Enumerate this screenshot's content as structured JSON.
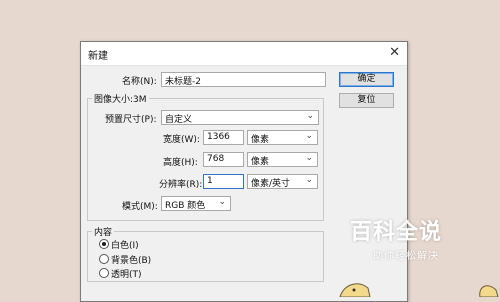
{
  "dialog": {
    "title": "新建",
    "close_glyph": "✕",
    "name_label": "名称(N):",
    "name_value": "未标题-2",
    "ok_label": "确定",
    "reset_label": "复位",
    "size_group_title": "图像大小:3M",
    "preset_label": "预置尺寸(P):",
    "preset_value": "自定义",
    "width_label": "宽度(W):",
    "width_value": "1366",
    "width_unit": "像素",
    "height_label": "高度(H):",
    "height_value": "768",
    "height_unit": "像素",
    "resolution_label": "分辨率(R):",
    "resolution_value": "1",
    "resolution_unit": "像素/英寸",
    "mode_label": "模式(M):",
    "mode_value": "RGB 颜色",
    "content_group_title": "内容",
    "content_options": [
      {
        "label": "白色(I)",
        "selected": true
      },
      {
        "label": "背景色(B)",
        "selected": false
      },
      {
        "label": "透明(T)",
        "selected": false
      }
    ]
  },
  "watermark": {
    "main": "百科全说",
    "sub": "助你轻松解决"
  },
  "colors": {
    "desktop_bg": "#e7d8cf",
    "dialog_bg": "#f0f0f0",
    "focus_accent": "#2e74c9"
  },
  "icons": {
    "close": "close-icon",
    "dropdown": "chevron-down-icon"
  }
}
